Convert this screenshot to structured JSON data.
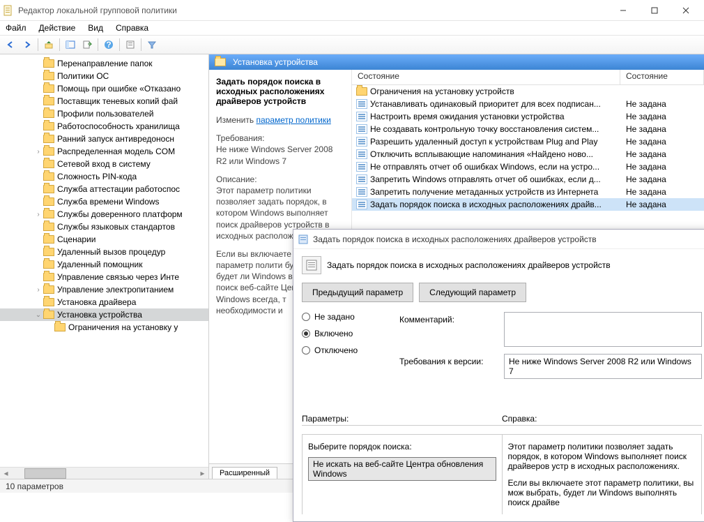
{
  "window": {
    "title": "Редактор локальной групповой политики"
  },
  "menu": {
    "file": "Файл",
    "action": "Действие",
    "view": "Вид",
    "help": "Справка"
  },
  "tree": [
    {
      "indent": 3,
      "exp": "",
      "label": "Перенаправление папок"
    },
    {
      "indent": 3,
      "exp": "",
      "label": "Политики ОС"
    },
    {
      "indent": 3,
      "exp": "",
      "label": "Помощь при ошибке «Отказано"
    },
    {
      "indent": 3,
      "exp": "",
      "label": "Поставщик теневых копий фай"
    },
    {
      "indent": 3,
      "exp": "",
      "label": "Профили пользователей"
    },
    {
      "indent": 3,
      "exp": "",
      "label": "Работоспособность хранилища"
    },
    {
      "indent": 3,
      "exp": "",
      "label": "Ранний запуск антивредоносн"
    },
    {
      "indent": 3,
      "exp": ">",
      "label": "Распределенная модель COM"
    },
    {
      "indent": 3,
      "exp": "",
      "label": "Сетевой вход в систему"
    },
    {
      "indent": 3,
      "exp": "",
      "label": "Сложность PIN-кода"
    },
    {
      "indent": 3,
      "exp": "",
      "label": "Служба аттестации работоспос"
    },
    {
      "indent": 3,
      "exp": "",
      "label": "Служба времени Windows"
    },
    {
      "indent": 3,
      "exp": ">",
      "label": "Службы доверенного платформ"
    },
    {
      "indent": 3,
      "exp": "",
      "label": "Службы языковых стандартов"
    },
    {
      "indent": 3,
      "exp": "",
      "label": "Сценарии"
    },
    {
      "indent": 3,
      "exp": "",
      "label": "Удаленный вызов процедур"
    },
    {
      "indent": 3,
      "exp": "",
      "label": "Удаленный помощник"
    },
    {
      "indent": 3,
      "exp": "",
      "label": "Управление связью через Инте"
    },
    {
      "indent": 3,
      "exp": ">",
      "label": "Управление электропитанием"
    },
    {
      "indent": 3,
      "exp": "",
      "label": "Установка драйвера"
    },
    {
      "indent": 3,
      "exp": "v",
      "label": "Установка устройства",
      "selected": true
    },
    {
      "indent": 4,
      "exp": "",
      "label": "Ограничения на установку у"
    }
  ],
  "category": {
    "title": "Установка устройства"
  },
  "detail": {
    "heading": "Задать порядок поиска в исходных расположениях драйверов устройств",
    "edit_label": "Изменить",
    "edit_link": "параметр политики",
    "req_label": "Требования:",
    "req_text": "Не ниже Windows Server 2008 R2 или Windows 7",
    "desc_label": "Описание:",
    "desc_text": "Этот параметр политики позволяет задать порядок, в котором Windows выполняет поиск драйверов устройств в исходных располож",
    "desc_more": "Если вы включаете этот параметр полити будет выбрать, будет ли Windows выполнять поиск веб-сайте Центра Windows всегда, т необходимости и"
  },
  "tabs": {
    "extended": "Расширенный"
  },
  "list": {
    "col_name": "Состояние",
    "col_state": "Состояние",
    "rows": [
      {
        "icon": "folder",
        "name": "Ограничения на установку устройств",
        "state": ""
      },
      {
        "icon": "setting",
        "name": "Устанавливать одинаковый приоритет для всех подписан...",
        "state": "Не задана"
      },
      {
        "icon": "setting",
        "name": "Настроить время ожидания установки устройства",
        "state": "Не задана"
      },
      {
        "icon": "setting",
        "name": "Не создавать контрольную точку восстановления систем...",
        "state": "Не задана"
      },
      {
        "icon": "setting",
        "name": "Разрешить удаленный доступ к устройствам Plug and Play",
        "state": "Не задана"
      },
      {
        "icon": "setting",
        "name": "Отключить всплывающие напоминания «Найдено ново...",
        "state": "Не задана"
      },
      {
        "icon": "setting",
        "name": "Не отправлять отчет об ошибках Windows, если на устро...",
        "state": "Не задана"
      },
      {
        "icon": "setting",
        "name": "Запретить Windows отправлять отчет об ошибках, если д...",
        "state": "Не задана"
      },
      {
        "icon": "setting",
        "name": "Запретить получение метаданных устройств из Интернета",
        "state": "Не задана"
      },
      {
        "icon": "setting",
        "name": "Задать порядок поиска в исходных расположениях драйв...",
        "state": "Не задана",
        "selected": true
      }
    ]
  },
  "status": {
    "text": "10 параметров"
  },
  "dialog": {
    "title": "Задать порядок поиска в исходных расположениях драйверов устройств",
    "setting_name": "Задать порядок поиска в исходных расположениях драйверов устройств",
    "prev": "Предыдущий параметр",
    "next": "Следующий параметр",
    "not_configured": "Не задано",
    "enabled": "Включено",
    "disabled": "Отключено",
    "comment_label": "Комментарий:",
    "supported_label": "Требования к версии:",
    "supported_text": "Не ниже Windows Server 2008 R2 или Windows 7",
    "params_label": "Параметры:",
    "help_label": "Справка:",
    "option_label": "Выберите порядок поиска:",
    "option_value": "Не искать на веб-сайте Центра обновления Windows",
    "help_text1": "Этот параметр политики позволяет задать порядок, в котором Windows выполняет поиск драйверов устр в исходных расположениях.",
    "help_text2": "Если вы включаете этот параметр политики, вы мож выбрать, будет ли Windows выполнять поиск драйве"
  }
}
